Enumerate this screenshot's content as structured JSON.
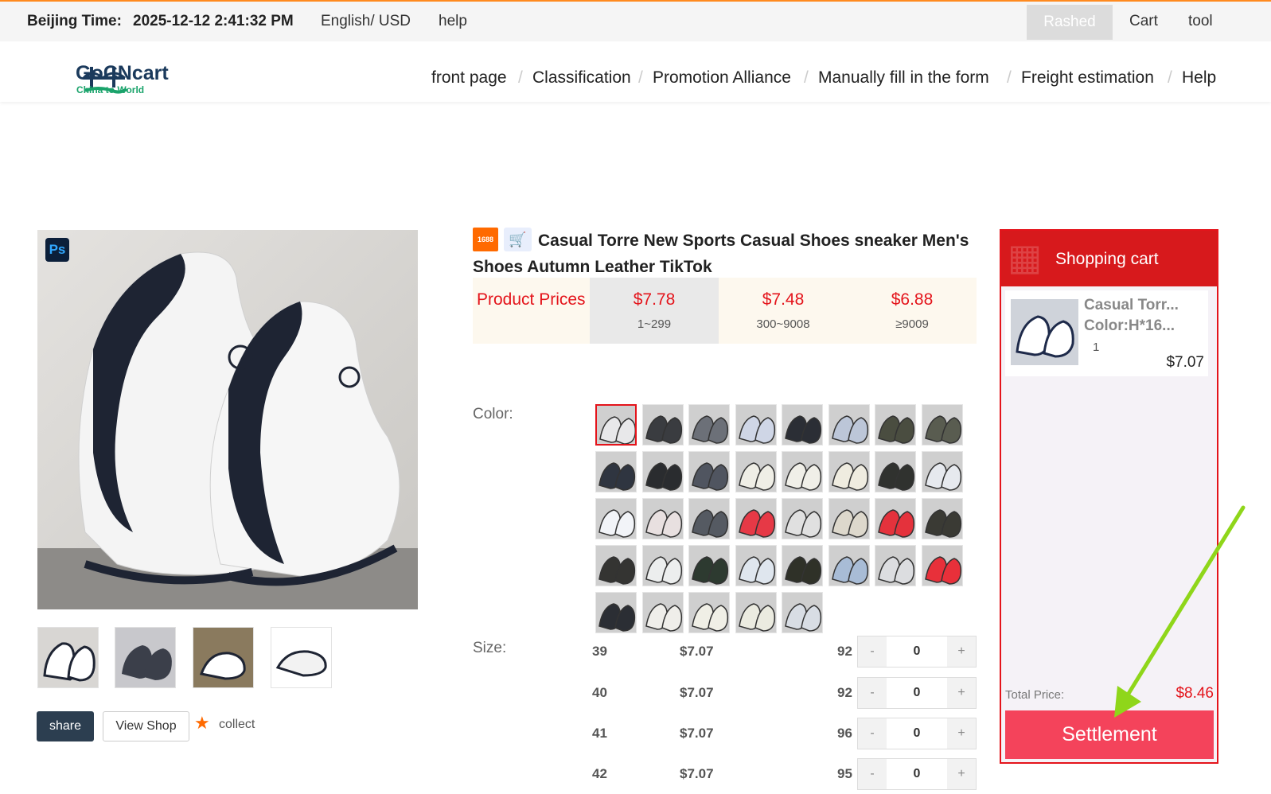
{
  "topbar": {
    "time_label": "Beijing Time:",
    "time_value": "2025-12-12 2:41:32 PM",
    "language": "English/ USD",
    "help": "help",
    "user": "Rashed",
    "cart": "Cart",
    "tool": "tool"
  },
  "header": {
    "logo_name": "GoCNcart",
    "logo_tagline": "China to World",
    "nav": [
      "front page",
      "Classification",
      "Promotion Alliance",
      "Manually fill in the form",
      "Freight estimation",
      "Help"
    ]
  },
  "gallery": {
    "ps_badge": "Ps",
    "share": "share",
    "view_shop": "View Shop",
    "collect": "collect"
  },
  "product": {
    "source_badge": "1688",
    "title": "Casual Torre New Sports Casual Shoes sneaker Men's Shoes Autumn Leather TikTok",
    "price_label": "Product Prices",
    "tiers": [
      {
        "price": "$7.78",
        "range": "1~299"
      },
      {
        "price": "$7.48",
        "range": "300~9008"
      },
      {
        "price": "$6.88",
        "range": "≥9009"
      }
    ],
    "color_label": "Color:",
    "size_label": "Size:",
    "sizes": [
      {
        "size": "39",
        "price": "$7.07",
        "stock": "92",
        "qty": "0"
      },
      {
        "size": "40",
        "price": "$7.07",
        "stock": "92",
        "qty": "0"
      },
      {
        "size": "41",
        "price": "$7.07",
        "stock": "96",
        "qty": "0"
      },
      {
        "size": "42",
        "price": "$7.07",
        "stock": "95",
        "qty": "0"
      }
    ],
    "stepper_minus": "-",
    "stepper_plus": "+"
  },
  "cart": {
    "title": "Shopping cart",
    "item_title": "Casual Torr...",
    "item_color": "Color:H*16...",
    "item_qty": "1",
    "item_price": "$7.07",
    "total_label": "Total Price:",
    "total_value": "$8.46",
    "settle": "Settlement"
  },
  "colors": {
    "accent_red": "#e4141b",
    "settle_pink": "#f4435b",
    "arrow_green": "#8fd61a",
    "nav_dark": "#2c3e50"
  }
}
